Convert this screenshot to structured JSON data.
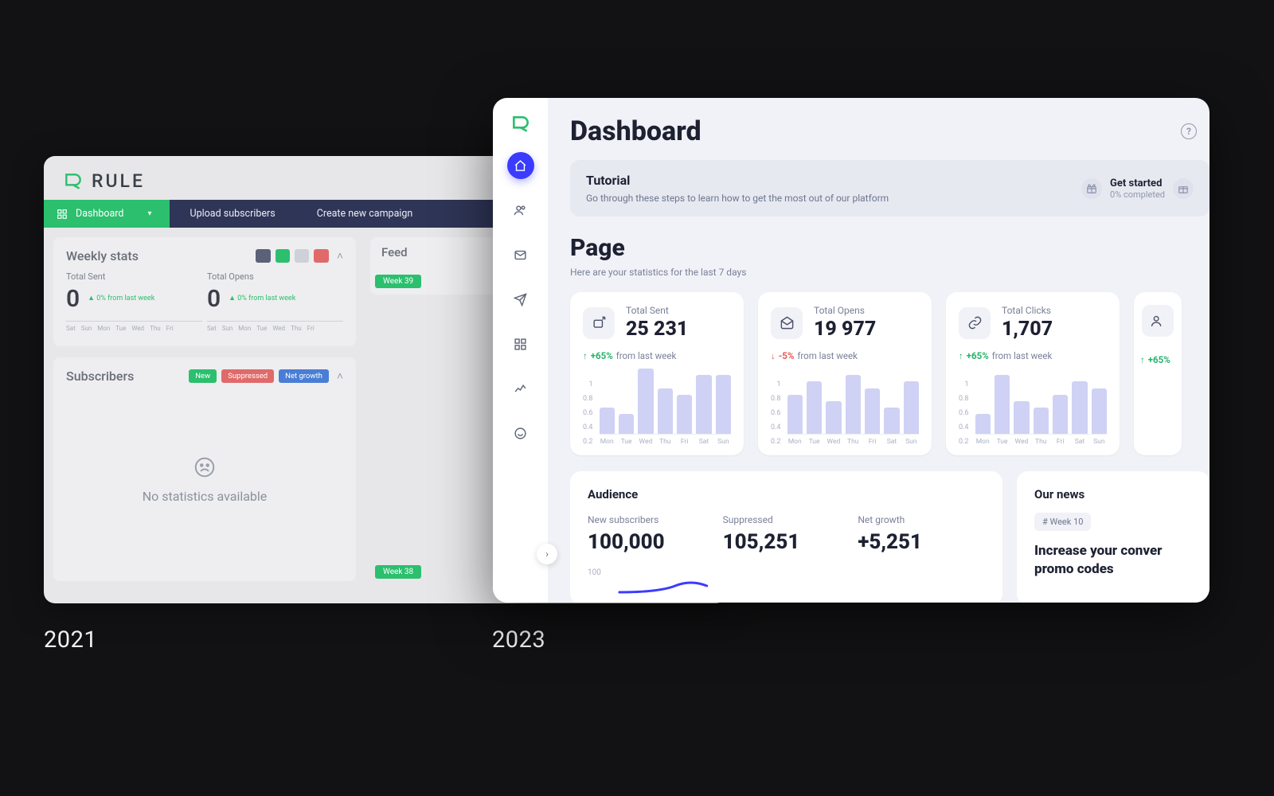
{
  "captions": {
    "y2021": "2021",
    "y2023": "2023"
  },
  "old": {
    "brand": "RULE",
    "nav": {
      "dashboard": "Dashboard",
      "upload": "Upload subscribers",
      "create": "Create new campaign"
    },
    "weekly": {
      "title": "Weekly stats",
      "totalSent": {
        "label": "Total Sent",
        "value": "0",
        "delta": "0% from last week"
      },
      "totalOpens": {
        "label": "Total Opens",
        "value": "0",
        "delta": "0% from last week"
      },
      "days": [
        "Sat",
        "Sun",
        "Mon",
        "Tue",
        "Wed",
        "Thu",
        "Fri"
      ]
    },
    "subscribers": {
      "title": "Subscribers",
      "pills": [
        "New",
        "Suppressed",
        "Net growth"
      ],
      "empty": "No statistics available"
    },
    "feed": {
      "title": "Feed",
      "week39": "Week 39",
      "week38": "Week 38"
    }
  },
  "new": {
    "title": "Dashboard",
    "tutorial": {
      "title": "Tutorial",
      "sub": "Go through these steps to learn how to get the most out of our platform",
      "getStarted": "Get started",
      "completed": "0% completed"
    },
    "page": {
      "title": "Page",
      "sub": "Here are your statistics for the last 7 days"
    },
    "deltaSuffix": "from last week",
    "cards": {
      "sent": {
        "label": "Total Sent",
        "value": "25 231",
        "deltaPct": "+65%",
        "trend": "up"
      },
      "opens": {
        "label": "Total Opens",
        "value": "19 977",
        "deltaPct": "-5%",
        "trend": "down"
      },
      "clicks": {
        "label": "Total Clicks",
        "value": "1,707",
        "deltaPct": "+65%",
        "trend": "up"
      },
      "extra": {
        "deltaPct": "+65%",
        "trend": "up"
      }
    },
    "audience": {
      "title": "Audience",
      "newSubscribers": {
        "label": "New subscribers",
        "value": "100,000"
      },
      "suppressed": {
        "label": "Suppressed",
        "value": "105,251"
      },
      "netGrowth": {
        "label": "Net growth",
        "value": "+5,251"
      },
      "ytick": "100"
    },
    "news": {
      "title": "Our news",
      "week": "# Week 10",
      "headline1": "Increase your conver",
      "headline2": "promo codes"
    }
  },
  "chart_data": [
    {
      "type": "bar",
      "title": "Total Sent — last 7 days",
      "categories": [
        "Mon",
        "Tue",
        "Wed",
        "Thu",
        "Fri",
        "Sat",
        "Sun"
      ],
      "values": [
        0.4,
        0.3,
        1.0,
        0.7,
        0.6,
        0.9,
        0.9
      ],
      "ylim": [
        0,
        1
      ],
      "yticks": [
        0.2,
        0.4,
        0.6,
        0.8,
        1
      ]
    },
    {
      "type": "bar",
      "title": "Total Opens — last 7 days",
      "categories": [
        "Mon",
        "Tue",
        "Wed",
        "Thu",
        "Fri",
        "Sat",
        "Sun"
      ],
      "values": [
        0.6,
        0.8,
        0.5,
        0.9,
        0.7,
        0.4,
        0.8
      ],
      "ylim": [
        0,
        1
      ],
      "yticks": [
        0.2,
        0.4,
        0.6,
        0.8,
        1
      ]
    },
    {
      "type": "bar",
      "title": "Total Clicks — last 7 days",
      "categories": [
        "Mon",
        "Tue",
        "Wed",
        "Thu",
        "Fri",
        "Sat",
        "Sun"
      ],
      "values": [
        0.3,
        0.9,
        0.5,
        0.4,
        0.6,
        0.8,
        0.7
      ],
      "ylim": [
        0,
        1
      ],
      "yticks": [
        0.2,
        0.4,
        0.6,
        0.8,
        1
      ]
    }
  ]
}
